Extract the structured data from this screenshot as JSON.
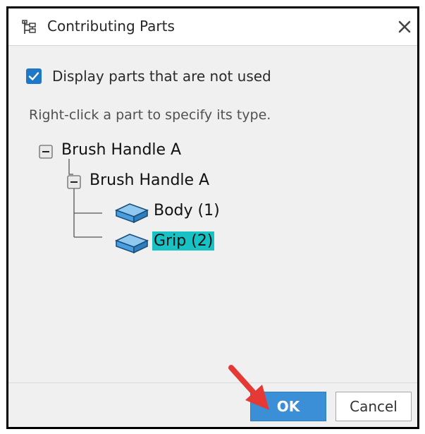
{
  "dialog": {
    "title": "Contributing Parts",
    "title_icon": "assembly-tree-icon",
    "close_icon": "close-icon"
  },
  "options": {
    "display_unused_label": "Display parts that are not used",
    "display_unused_checked": true
  },
  "hint": "Right-click a part to specify its type.",
  "tree": {
    "root": {
      "label": "Brush Handle A",
      "expanded": true
    },
    "child": {
      "label": "Brush Handle A",
      "expanded": true
    },
    "parts": [
      {
        "label": "Body (1)",
        "selected": false,
        "icon": "solid-body-icon"
      },
      {
        "label": "Grip (2)",
        "selected": true,
        "icon": "solid-body-icon"
      }
    ]
  },
  "buttons": {
    "ok_label": "OK",
    "cancel_label": "Cancel"
  },
  "colors": {
    "accent": "#3a8fd6",
    "selection": "#18c1c4",
    "annotation_arrow": "#e53935"
  }
}
